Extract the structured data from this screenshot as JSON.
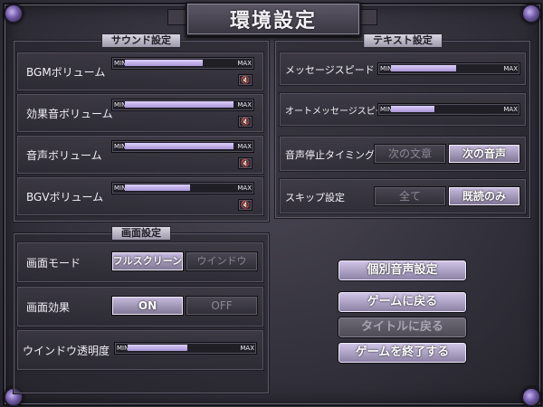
{
  "title": "環境設定",
  "sound": {
    "header": "サウンド設定",
    "min_label": "MIN",
    "max_label": "MAX",
    "rows": [
      {
        "label": "BGMボリューム",
        "level": 0.72
      },
      {
        "label": "効果音ボリューム",
        "level": 1.0
      },
      {
        "label": "音声ボリューム",
        "level": 1.0
      },
      {
        "label": "BGVボリューム",
        "level": 0.6
      }
    ],
    "mute_icon": "speaker-mute-icon"
  },
  "text": {
    "header": "テキスト設定",
    "message_speed": {
      "label": "メッセージスピード",
      "level": 0.6
    },
    "auto_speed": {
      "label": "オートメッセージスピード",
      "level": 0.4
    },
    "voice_stop": {
      "label": "音声停止タイミング",
      "options": [
        "次の文章",
        "次の音声"
      ],
      "selected": 1
    },
    "skip": {
      "label": "スキップ設定",
      "options": [
        "全て",
        "既読のみ"
      ],
      "selected": 1
    }
  },
  "screen": {
    "header": "画面設定",
    "mode": {
      "label": "画面モード",
      "options": [
        "フルスクリーン",
        "ウインドウ"
      ],
      "selected": 0
    },
    "effect": {
      "label": "画面効果",
      "options": [
        "ON",
        "OFF"
      ],
      "selected": 0
    },
    "window_opacity": {
      "label": "ウインドウ透明度",
      "level": 0.55
    }
  },
  "buttons": {
    "voice_settings": "個別音声設定",
    "return_game": "ゲームに戻る",
    "return_title": "タイトルに戻る",
    "quit_game": "ゲームを終了する"
  }
}
